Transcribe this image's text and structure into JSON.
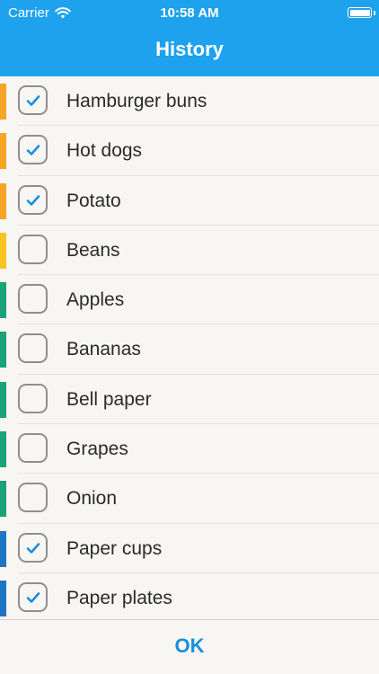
{
  "status_bar": {
    "carrier": "Carrier",
    "time": "10:58 AM"
  },
  "header": {
    "title": "History"
  },
  "colors": {
    "header_bg": "#1fa2ed",
    "checkmark": "#1a8fdc",
    "ok_text": "#1a8fdc"
  },
  "items": [
    {
      "label": "Hamburger buns",
      "checked": true,
      "color": "#f5a623"
    },
    {
      "label": "Hot dogs",
      "checked": true,
      "color": "#f5a623"
    },
    {
      "label": "Potato",
      "checked": true,
      "color": "#f5a623"
    },
    {
      "label": "Beans",
      "checked": false,
      "color": "#f7c51e"
    },
    {
      "label": "Apples",
      "checked": false,
      "color": "#1aa37a"
    },
    {
      "label": "Bananas",
      "checked": false,
      "color": "#1aa37a"
    },
    {
      "label": "Bell paper",
      "checked": false,
      "color": "#1aa37a"
    },
    {
      "label": "Grapes",
      "checked": false,
      "color": "#1aa37a"
    },
    {
      "label": "Onion",
      "checked": false,
      "color": "#1aa37a"
    },
    {
      "label": "Paper cups",
      "checked": true,
      "color": "#1f74c4"
    },
    {
      "label": "Paper plates",
      "checked": true,
      "color": "#1f74c4"
    }
  ],
  "footer": {
    "ok_label": "OK"
  }
}
